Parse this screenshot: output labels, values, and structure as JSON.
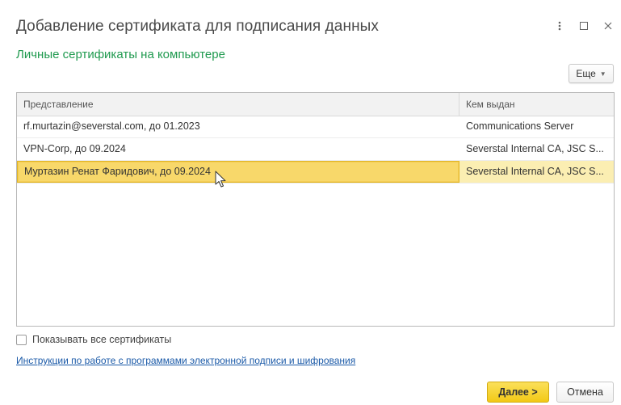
{
  "window": {
    "title": "Добавление сертификата для подписания данных",
    "controls": [
      "more-vert-icon",
      "maximize-icon",
      "close-icon"
    ]
  },
  "section_title": "Личные сертификаты на компьютере",
  "toolbar": {
    "more_label": "Еще"
  },
  "table": {
    "columns": [
      "Представление",
      "Кем выдан"
    ],
    "rows": [
      [
        "rf.murtazin@severstal.com, до 01.2023",
        "Communications Server"
      ],
      [
        "VPN-Corp, до 09.2024",
        "Severstal Internal CA, JSC S..."
      ],
      [
        "Муртазин Ренат Фаридович, до 09.2024",
        "Severstal Internal CA, JSC S..."
      ]
    ],
    "selected_row": 2
  },
  "show_all": {
    "label": "Показывать все сертификаты",
    "checked": false
  },
  "instructions_link": "Инструкции по работе с программами электронной подписи и шифрования",
  "buttons": {
    "next": "Далее >",
    "cancel": "Отмена"
  },
  "colors": {
    "section_title": "#1f9a4f",
    "selection": "#f8d86a",
    "primary_button": "#f2c916",
    "link": "#1b5aa8"
  }
}
